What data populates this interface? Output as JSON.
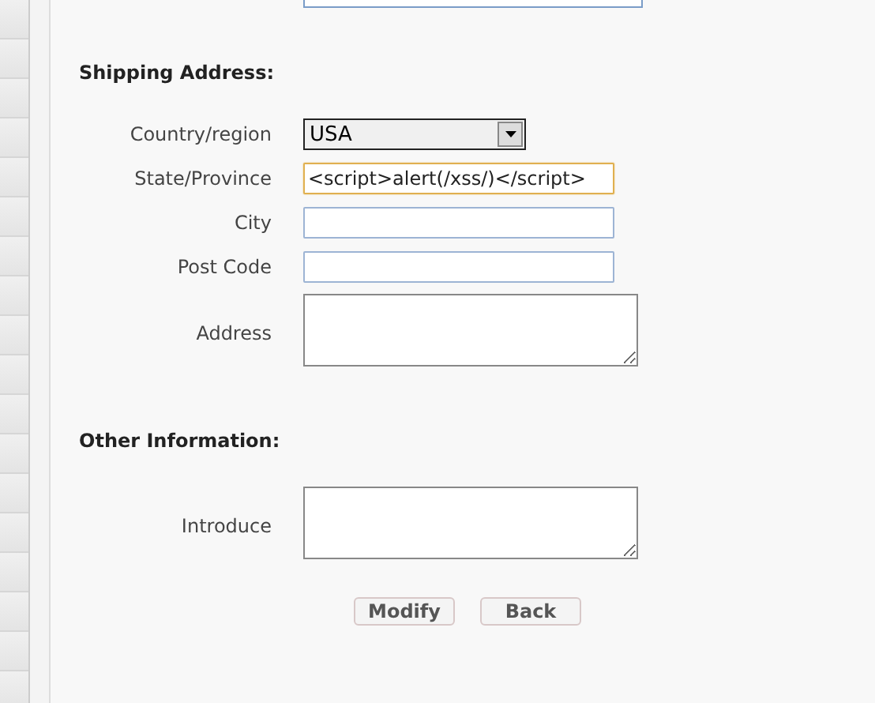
{
  "sections": [
    {
      "heading": "Shipping Address:",
      "fields": [
        {
          "label": "Country/region",
          "kind": "select",
          "value": "USA"
        },
        {
          "label": "State/Province",
          "kind": "text",
          "value": "<script>alert(/xss/)</script>",
          "focused": true
        },
        {
          "label": "City",
          "kind": "text",
          "focused": false
        },
        {
          "label": "Post Code",
          "kind": "text",
          "focused": false
        },
        {
          "label": "Address",
          "kind": "textarea"
        }
      ]
    },
    {
      "heading": "Other Information:",
      "fields": [
        {
          "label": "Introduce",
          "kind": "textarea"
        }
      ]
    }
  ],
  "buttons": [
    "Modify",
    "Back"
  ]
}
